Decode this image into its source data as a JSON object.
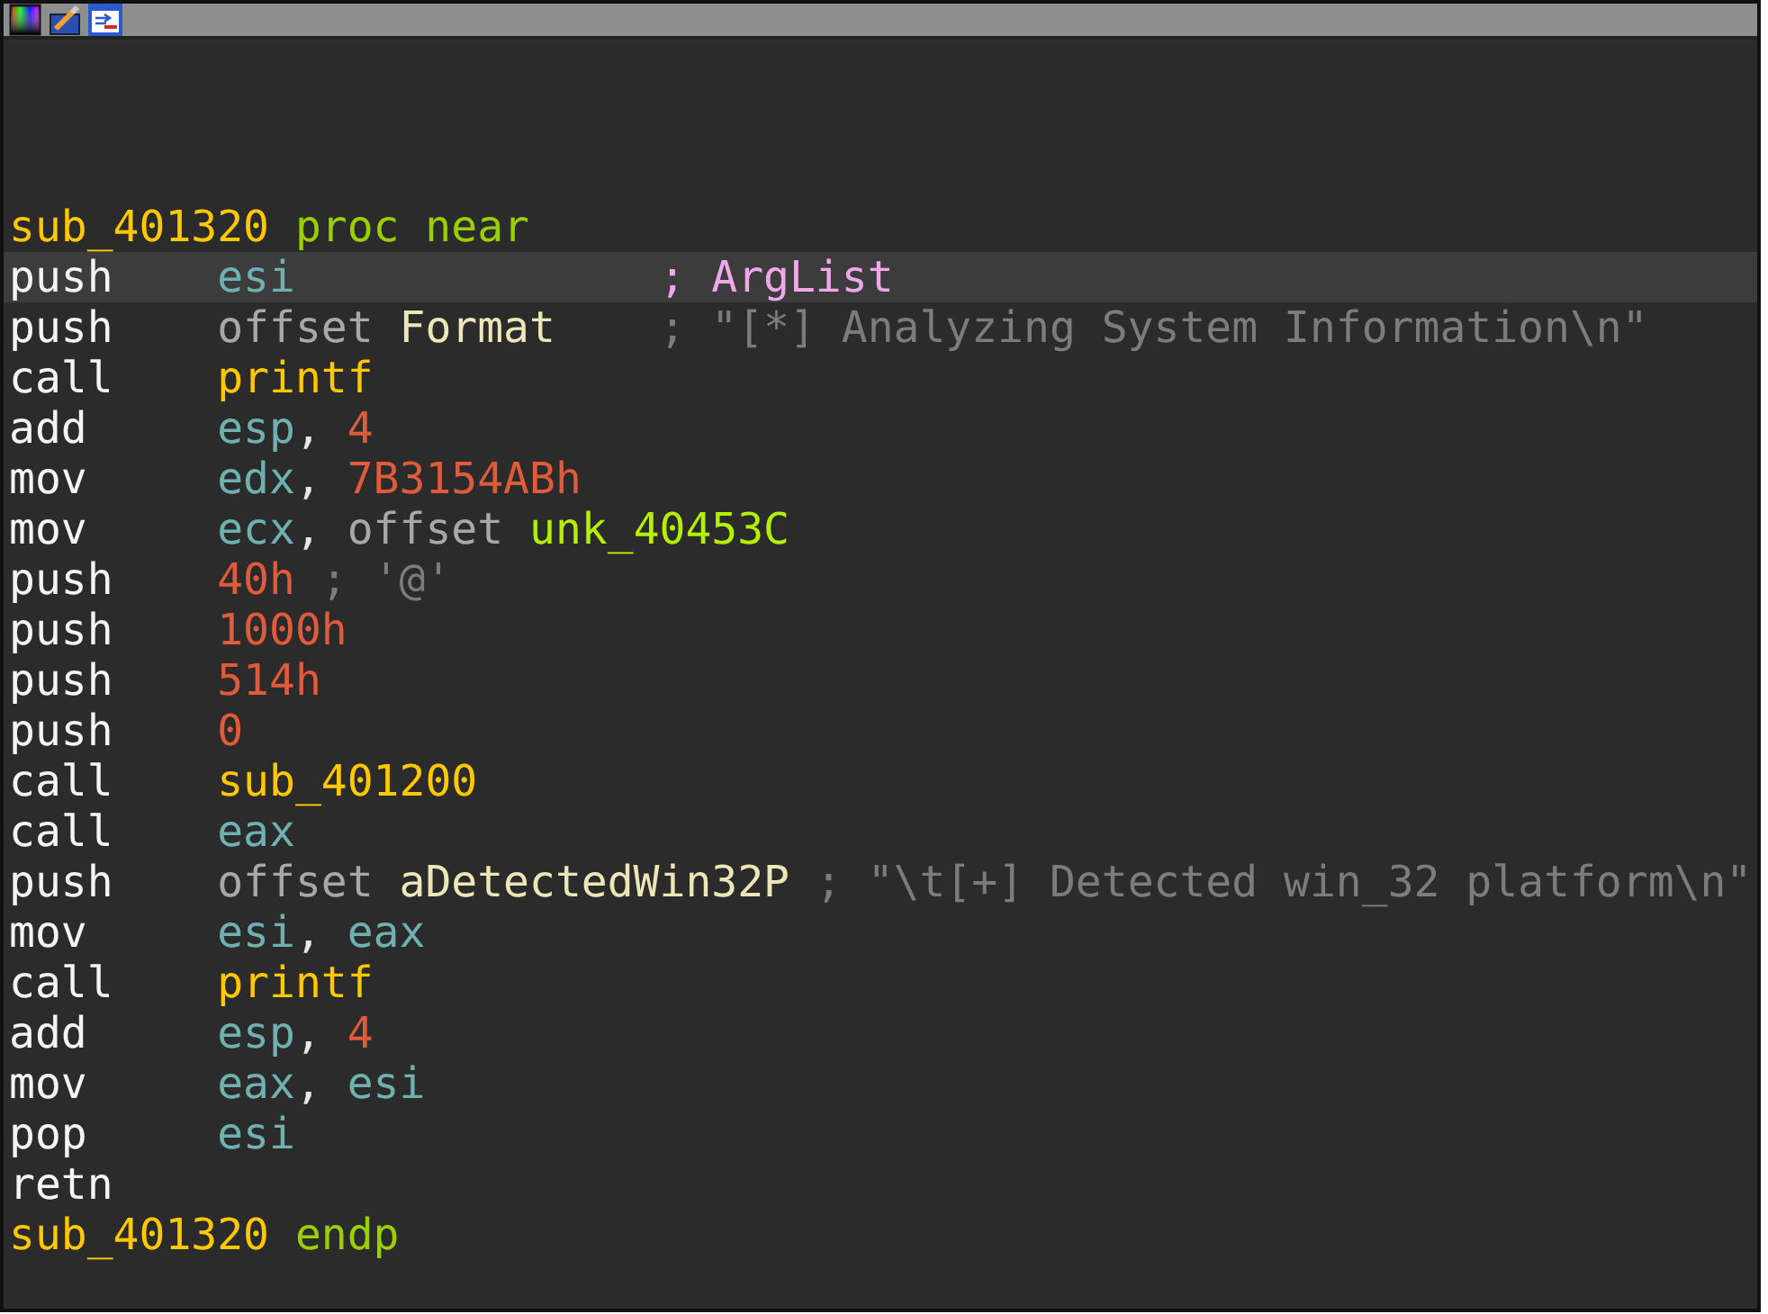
{
  "lines": [
    {
      "kind": "header",
      "name": "sub_401320",
      "directive": "proc near",
      "current": false
    },
    {
      "kind": "insn",
      "mnemonic": "push",
      "operands": [
        {
          "text": "esi",
          "kind": "reg"
        }
      ],
      "comment": {
        "text": "; ArgList",
        "kind": "arg",
        "aligned": true
      },
      "current": true
    },
    {
      "kind": "insn",
      "mnemonic": "push",
      "operands": [
        {
          "text": "offset",
          "kind": "keyword"
        },
        {
          "text": "Format",
          "kind": "data"
        }
      ],
      "comment": {
        "text": "; \"[*] Analyzing System Information\\n\"",
        "kind": "string",
        "aligned": true
      },
      "current": false
    },
    {
      "kind": "insn",
      "mnemonic": "call",
      "operands": [
        {
          "text": "printf",
          "kind": "func"
        }
      ],
      "current": false
    },
    {
      "kind": "insn",
      "mnemonic": "add",
      "operands": [
        {
          "text": "esp",
          "kind": "reg"
        },
        {
          "text": ",",
          "kind": "punct"
        },
        {
          "text": "4",
          "kind": "number"
        }
      ],
      "current": false
    },
    {
      "kind": "insn",
      "mnemonic": "mov",
      "operands": [
        {
          "text": "edx",
          "kind": "reg"
        },
        {
          "text": ",",
          "kind": "punct"
        },
        {
          "text": "7B3154ABh",
          "kind": "number"
        }
      ],
      "current": false
    },
    {
      "kind": "insn",
      "mnemonic": "mov",
      "operands": [
        {
          "text": "ecx",
          "kind": "reg"
        },
        {
          "text": ",",
          "kind": "punct"
        },
        {
          "text": "offset",
          "kind": "keyword"
        },
        {
          "text": "unk_40453C",
          "kind": "label"
        }
      ],
      "current": false
    },
    {
      "kind": "insn",
      "mnemonic": "push",
      "operands": [
        {
          "text": "40h",
          "kind": "number"
        }
      ],
      "comment": {
        "text": "; '@'",
        "kind": "string",
        "aligned": false
      },
      "current": false
    },
    {
      "kind": "insn",
      "mnemonic": "push",
      "operands": [
        {
          "text": "1000h",
          "kind": "number"
        }
      ],
      "current": false
    },
    {
      "kind": "insn",
      "mnemonic": "push",
      "operands": [
        {
          "text": "514h",
          "kind": "number"
        }
      ],
      "current": false
    },
    {
      "kind": "insn",
      "mnemonic": "push",
      "operands": [
        {
          "text": "0",
          "kind": "number"
        }
      ],
      "current": false
    },
    {
      "kind": "insn",
      "mnemonic": "call",
      "operands": [
        {
          "text": "sub_401200",
          "kind": "func"
        }
      ],
      "current": false
    },
    {
      "kind": "insn",
      "mnemonic": "call",
      "operands": [
        {
          "text": "eax",
          "kind": "reg"
        }
      ],
      "current": false
    },
    {
      "kind": "insn",
      "mnemonic": "push",
      "operands": [
        {
          "text": "offset",
          "kind": "keyword"
        },
        {
          "text": "aDetectedWin32P",
          "kind": "data"
        }
      ],
      "comment": {
        "text": "; \"\\t[+] Detected win_32 platform\\n\"",
        "kind": "string"
      },
      "current": false
    },
    {
      "kind": "insn",
      "mnemonic": "mov",
      "operands": [
        {
          "text": "esi",
          "kind": "reg"
        },
        {
          "text": ",",
          "kind": "punct"
        },
        {
          "text": "eax",
          "kind": "reg"
        }
      ],
      "current": false
    },
    {
      "kind": "insn",
      "mnemonic": "call",
      "operands": [
        {
          "text": "printf",
          "kind": "func"
        }
      ],
      "current": false
    },
    {
      "kind": "insn",
      "mnemonic": "add",
      "operands": [
        {
          "text": "esp",
          "kind": "reg"
        },
        {
          "text": ",",
          "kind": "punct"
        },
        {
          "text": "4",
          "kind": "number"
        }
      ],
      "current": false
    },
    {
      "kind": "insn",
      "mnemonic": "mov",
      "operands": [
        {
          "text": "eax",
          "kind": "reg"
        },
        {
          "text": ",",
          "kind": "punct"
        },
        {
          "text": "esi",
          "kind": "reg"
        }
      ],
      "current": false
    },
    {
      "kind": "insn",
      "mnemonic": "pop",
      "operands": [
        {
          "text": "esi",
          "kind": "reg"
        }
      ],
      "current": false
    },
    {
      "kind": "insn",
      "mnemonic": "retn",
      "current": false
    },
    {
      "kind": "header",
      "name": "sub_401320",
      "directive": "endp",
      "current": false
    }
  ]
}
